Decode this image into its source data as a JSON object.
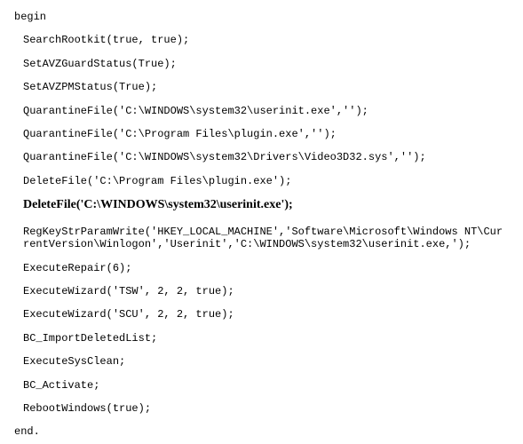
{
  "code": {
    "begin": "begin",
    "lines": [
      "SearchRootkit(true, true);",
      "SetAVZGuardStatus(True);",
      "SetAVZPMStatus(True);",
      "QuarantineFile('C:\\WINDOWS\\system32\\userinit.exe','');",
      "QuarantineFile('C:\\Program Files\\plugin.exe','');",
      "QuarantineFile('C:\\WINDOWS\\system32\\Drivers\\Video3D32.sys','');",
      "DeleteFile('C:\\Program Files\\plugin.exe');"
    ],
    "bold_line": "DeleteFile('C:\\WINDOWS\\system32\\userinit.exe');",
    "lines2": [
      "RegKeyStrParamWrite('HKEY_LOCAL_MACHINE','Software\\Microsoft\\Windows NT\\CurrentVersion\\Winlogon','Userinit','C:\\WINDOWS\\system32\\userinit.exe,');",
      "ExecuteRepair(6);",
      "ExecuteWizard('TSW', 2, 2, true);",
      "ExecuteWizard('SCU', 2, 2, true);",
      "BC_ImportDeletedList;",
      "ExecuteSysClean;",
      "BC_Activate;",
      "RebootWindows(true);"
    ],
    "end": "end."
  }
}
